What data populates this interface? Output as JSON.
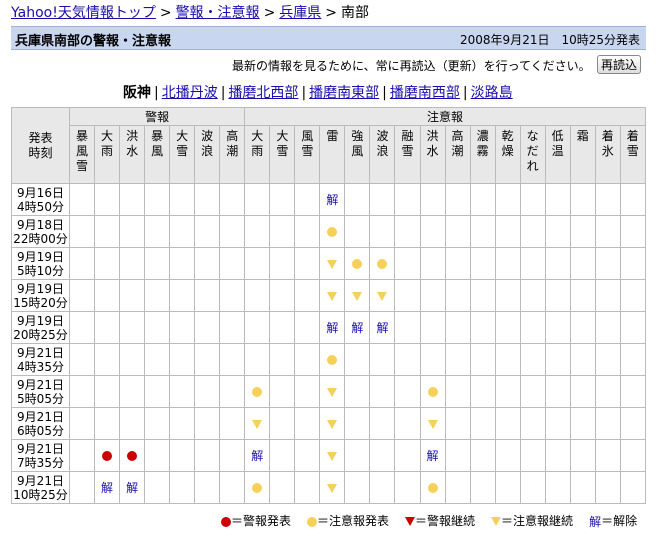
{
  "breadcrumb": {
    "items": [
      "Yahoo!天気情報トップ",
      "警報・注意報",
      "兵庫県"
    ],
    "current": "南部",
    "separator": ">"
  },
  "title": "兵庫県南部の警報・注意報",
  "datetime": "2008年9月21日　10時25分発表",
  "notice": "最新の情報を見るために、常に再読込（更新）を行ってください。",
  "reload_label": "再読込",
  "areas": {
    "current": "阪神",
    "links": [
      "北播丹波",
      "播磨北西部",
      "播磨南東部",
      "播磨南西部",
      "淡路島"
    ]
  },
  "table": {
    "corner": [
      "発表",
      "時刻"
    ],
    "groups": [
      {
        "label": "警報",
        "span": 7
      },
      {
        "label": "注意報",
        "span": 16
      }
    ],
    "columns": [
      "暴風雪",
      "大雨",
      "洪水",
      "暴風",
      "大雪",
      "波浪",
      "高潮",
      "大雨",
      "大雪",
      "風雪",
      "雷",
      "強風",
      "波浪",
      "融雪",
      "洪水",
      "高潮",
      "濃霧",
      "乾燥",
      "なだれ",
      "低温",
      "霜",
      "着氷",
      "着雪"
    ],
    "rows": [
      {
        "date": "9月16日",
        "time": "4時50分",
        "cells": {
          "10": "kai"
        }
      },
      {
        "date": "9月18日",
        "time": "22時00分",
        "cells": {
          "10": "yel"
        }
      },
      {
        "date": "9月19日",
        "time": "5時10分",
        "cells": {
          "10": "ytri",
          "11": "yel",
          "12": "yel"
        }
      },
      {
        "date": "9月19日",
        "time": "15時20分",
        "cells": {
          "10": "ytri",
          "11": "ytri",
          "12": "ytri"
        }
      },
      {
        "date": "9月19日",
        "time": "20時25分",
        "cells": {
          "10": "kai",
          "11": "kai",
          "12": "kai"
        }
      },
      {
        "date": "9月21日",
        "time": "4時35分",
        "cells": {
          "10": "yel"
        }
      },
      {
        "date": "9月21日",
        "time": "5時05分",
        "cells": {
          "7": "yel",
          "10": "ytri",
          "14": "yel"
        }
      },
      {
        "date": "9月21日",
        "time": "6時05分",
        "cells": {
          "7": "ytri",
          "10": "ytri",
          "14": "ytri"
        }
      },
      {
        "date": "9月21日",
        "time": "7時35分",
        "cells": {
          "1": "red",
          "2": "red",
          "7": "kai",
          "10": "ytri",
          "14": "kai"
        }
      },
      {
        "date": "9月21日",
        "time": "10時25分",
        "cells": {
          "1": "kai",
          "2": "kai",
          "7": "yel",
          "10": "ytri",
          "14": "yel"
        }
      }
    ]
  },
  "legend": [
    {
      "symbol": "red",
      "label": "＝警報発表"
    },
    {
      "symbol": "yel",
      "label": "＝注意報発表"
    },
    {
      "symbol": "rtri",
      "label": "＝警報継続"
    },
    {
      "symbol": "ytri",
      "label": "＝注意報継続"
    },
    {
      "symbol": "kai",
      "label": "＝解除"
    }
  ],
  "kai_text": "解",
  "colors": {
    "warning": "#cc0000",
    "advisory": "#f5d15a",
    "link": "#1a0dab",
    "title_bg": "#c9d6ef"
  }
}
